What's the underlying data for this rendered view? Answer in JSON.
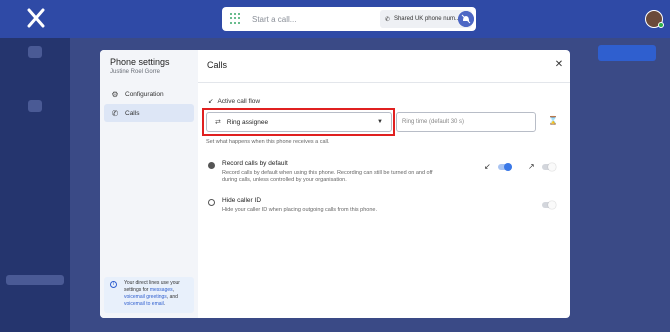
{
  "topbar": {
    "search_placeholder": "Start a call...",
    "line_label": "Shared UK phone num..."
  },
  "modal": {
    "sidebar": {
      "title": "Phone settings",
      "user": "Justine Roel Gorre",
      "items": [
        {
          "label": "Configuration",
          "icon": "gear-icon"
        },
        {
          "label": "Calls",
          "icon": "phone-icon",
          "active": true
        }
      ],
      "info": {
        "text_before": "Your direct lines use your settings for ",
        "link1": "messages",
        "comma": ", ",
        "link2": "voicemail greetings",
        "and": ", and ",
        "link3": "voicemail to email",
        "end": "."
      }
    },
    "content": {
      "title": "Calls",
      "active_call_flow": {
        "label": "Active call flow",
        "select_value": "Ring assignee",
        "ring_time_placeholder": "Ring time (default 30 s)",
        "hint": "Set what happens when this phone receives a call."
      },
      "record_calls": {
        "title": "Record calls by default",
        "description": "Record calls by default when using this phone. Recording can still be turned on and off during calls, unless controlled by your organisation.",
        "inbound_on": true,
        "outbound_on": false
      },
      "hide_caller_id": {
        "title": "Hide caller ID",
        "description": "Hide your caller ID when placing outgoing calls from this phone.",
        "on": false
      }
    }
  },
  "colors": {
    "accent": "#3a78e7",
    "highlight": "#e02020",
    "header": "#2f4aa6"
  }
}
